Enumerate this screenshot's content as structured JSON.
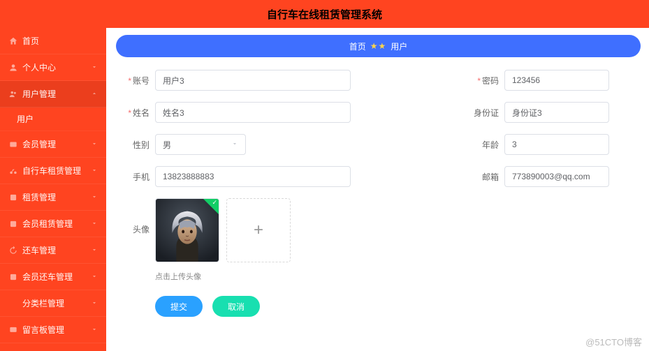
{
  "app_title": "自行车在线租赁管理系统",
  "sidebar": {
    "items": [
      {
        "icon": "home-icon",
        "label": "首页"
      },
      {
        "icon": "user-icon",
        "label": "个人中心"
      },
      {
        "icon": "users-icon",
        "label": "用户管理",
        "expanded": true,
        "children": [
          {
            "label": "用户"
          }
        ]
      },
      {
        "icon": "member-icon",
        "label": "会员管理"
      },
      {
        "icon": "bike-icon",
        "label": "自行车租赁管理"
      },
      {
        "icon": "rent-icon",
        "label": "租赁管理"
      },
      {
        "icon": "member-rent-icon",
        "label": "会员租赁管理"
      },
      {
        "icon": "return-icon",
        "label": "还车管理"
      },
      {
        "icon": "member-return-icon",
        "label": "会员还车管理"
      },
      {
        "icon": "category-icon",
        "label": "分类栏管理"
      },
      {
        "icon": "board-icon",
        "label": "留言板管理"
      }
    ]
  },
  "breadcrumb": {
    "home": "首页",
    "stars": "★★",
    "current": "用户"
  },
  "form": {
    "account": {
      "label": "账号",
      "value": "用户3",
      "required": true
    },
    "password": {
      "label": "密码",
      "value": "123456",
      "required": true
    },
    "name": {
      "label": "姓名",
      "value": "姓名3",
      "required": true
    },
    "idcard": {
      "label": "身份证",
      "value": "身份证3"
    },
    "gender": {
      "label": "性别",
      "value": "男"
    },
    "age": {
      "label": "年龄",
      "value": "3"
    },
    "phone": {
      "label": "手机",
      "value": "13823888883"
    },
    "email": {
      "label": "邮箱",
      "value": "773890003@qq.com"
    },
    "avatar": {
      "label": "头像",
      "hint": "点击上传头像"
    }
  },
  "actions": {
    "submit": "提交",
    "cancel": "取消"
  },
  "watermark": "@51CTO博客"
}
